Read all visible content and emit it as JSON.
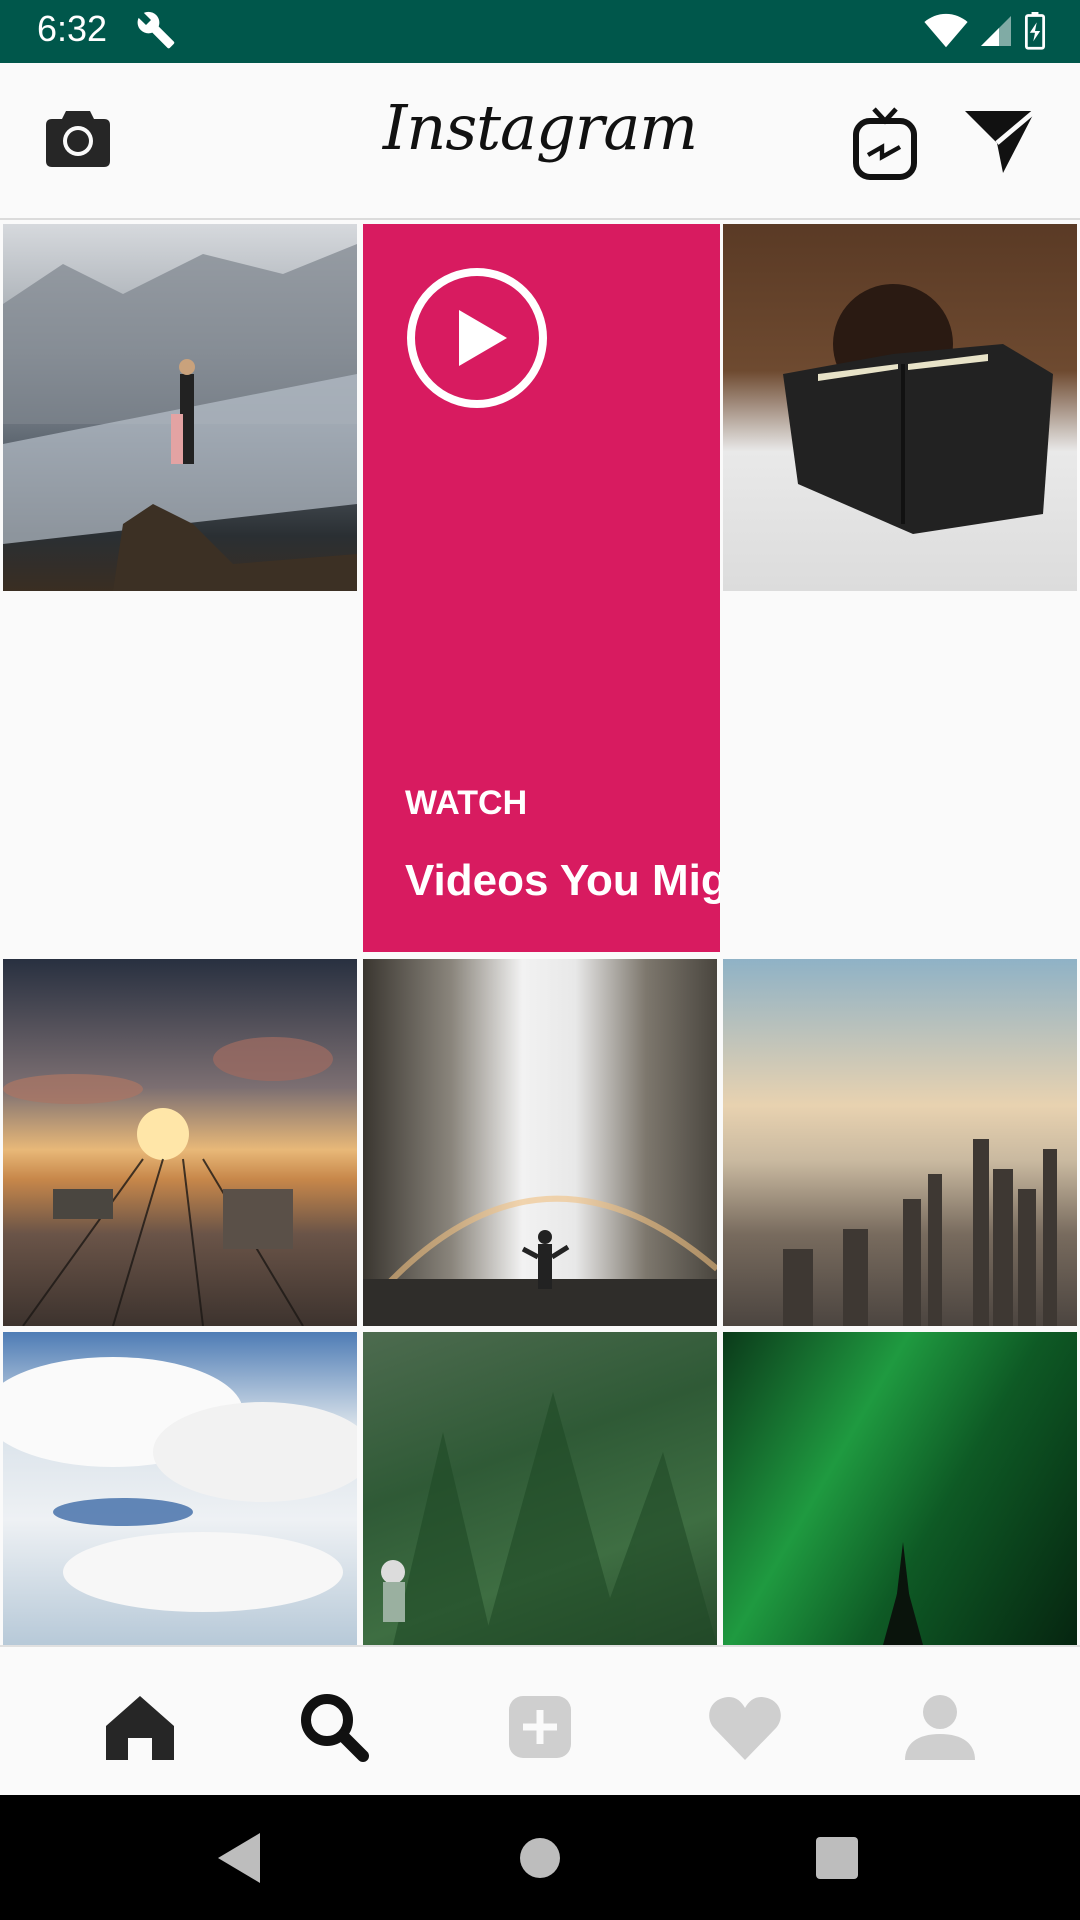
{
  "status_bar": {
    "time": "6:32",
    "icons": [
      "wrench-icon",
      "wifi-icon",
      "signal-icon",
      "battery-icon"
    ],
    "background": "#00574b"
  },
  "header": {
    "app_title": "Instagram",
    "left_icon": "camera-icon",
    "right_icons": [
      "igtv-icon",
      "direct-message-icon"
    ]
  },
  "grid": {
    "tiles": [
      {
        "name": "mountain-lake-photo"
      },
      {
        "name": "watch-videos-card",
        "label": "WATCH",
        "title": "Videos You Mig",
        "accent": "#d81b60",
        "icon": "play-icon"
      },
      {
        "name": "bible-reading-photo"
      },
      {
        "name": "railway-sunset-photo"
      },
      {
        "name": "waterfall-rainbow-photo"
      },
      {
        "name": "city-skyline-photo"
      },
      {
        "name": "clouds-sky-photo"
      },
      {
        "name": "forest-hiker-photo"
      },
      {
        "name": "aurora-photo"
      }
    ]
  },
  "bottom_nav": {
    "items": [
      "home-icon",
      "search-icon",
      "add-post-icon",
      "activity-heart-icon",
      "profile-icon"
    ],
    "active": "search-icon"
  },
  "system_nav": {
    "items": [
      "back-icon",
      "home-circle-icon",
      "recents-icon"
    ]
  }
}
